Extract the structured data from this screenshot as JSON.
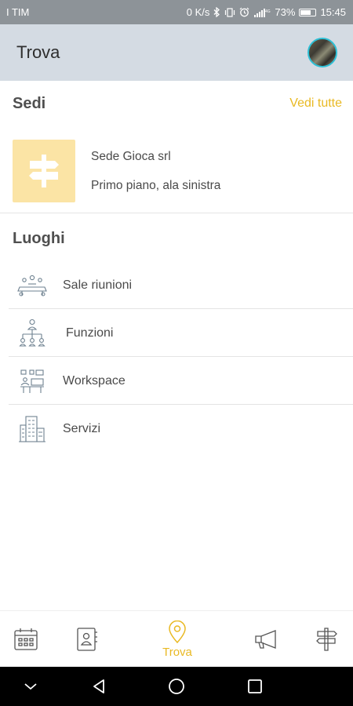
{
  "status_bar": {
    "carrier": "I TIM",
    "speed": "0 K/s",
    "battery": "73%",
    "battery_level": 0.73,
    "time": "15:45",
    "icons": [
      "bluetooth-icon",
      "vibrate-icon",
      "alarm-icon",
      "signal-icon",
      "battery-icon"
    ]
  },
  "header": {
    "title": "Trova",
    "avatar_icon": "user-avatar"
  },
  "sedi": {
    "title": "Sedi",
    "see_all": "Vedi tutte",
    "items": [
      {
        "name": "Sede Gioca srl",
        "description": "Primo piano, ala sinistra",
        "icon": "signpost-icon"
      }
    ]
  },
  "luoghi": {
    "title": "Luoghi",
    "items": [
      {
        "label": "Sale riunioni",
        "icon": "meeting-room-icon"
      },
      {
        "label": "Funzioni",
        "icon": "org-chart-icon"
      },
      {
        "label": "Workspace",
        "icon": "workspace-icon"
      },
      {
        "label": "Servizi",
        "icon": "building-icon"
      }
    ]
  },
  "bottom_nav": {
    "items": [
      {
        "icon": "calendar-icon",
        "label": ""
      },
      {
        "icon": "contacts-icon",
        "label": ""
      },
      {
        "icon": "location-pin-icon",
        "label": "Trova",
        "active": true
      },
      {
        "icon": "megaphone-icon",
        "label": ""
      },
      {
        "icon": "signpost-icon",
        "label": ""
      }
    ]
  },
  "colors": {
    "accent": "#e9b923",
    "header_bg": "#d4dbe3",
    "status_bar_bg": "#8d9398",
    "thumb_bg": "#fbe4a5",
    "avatar_ring": "#2ec0d6"
  }
}
